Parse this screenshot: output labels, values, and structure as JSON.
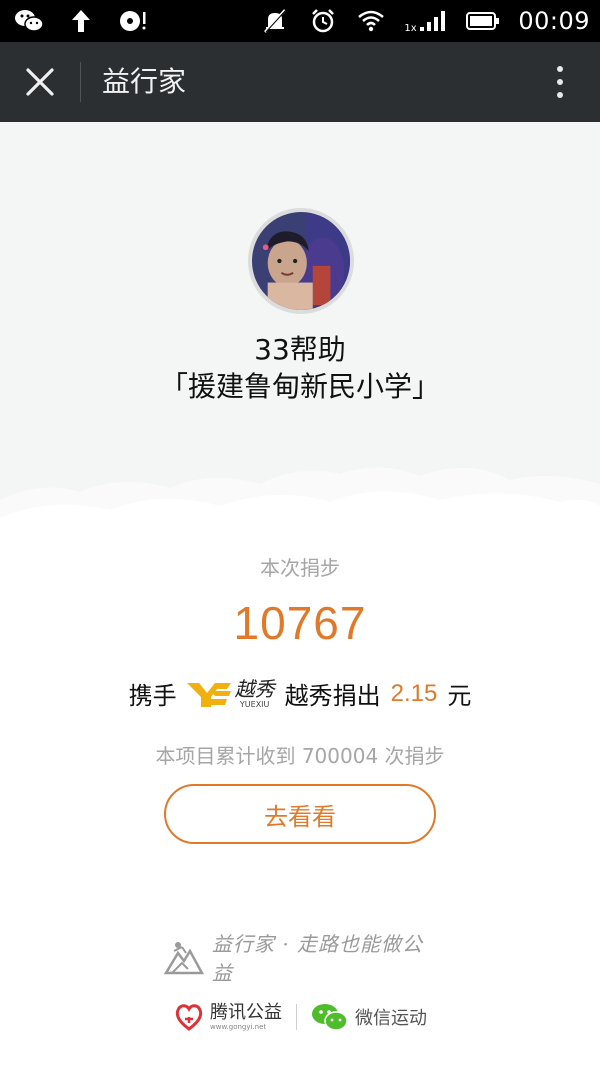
{
  "status_bar": {
    "time": "00:09",
    "network_label": "1x",
    "icons": [
      "wechat-icon",
      "upload-arrow-icon",
      "media-icon",
      "notification-muted-icon",
      "alarm-icon",
      "wifi-icon",
      "signal-icon",
      "battery-icon"
    ]
  },
  "titlebar": {
    "title": "益行家",
    "close_icon": "close-icon",
    "more_icon": "more-vertical-icon"
  },
  "hero": {
    "title": "33帮助",
    "subtitle": "「援建鲁甸新民小学」"
  },
  "donation": {
    "label": "本次捐步",
    "steps": "10767",
    "prefix": "携手",
    "sponsor_logo_text": "越秀",
    "sponsor_logo_sub": "YUEXIU",
    "middle": "越秀捐出",
    "amount": "2.15",
    "unit": "元",
    "accum_text": "本项目累计收到 700004 次捐步",
    "button_label": "去看看"
  },
  "footer": {
    "brand": "益行家 · 走路也能做公益",
    "tencent_label": "腾讯公益",
    "tencent_url": "www.gongyi.net",
    "wechat_label": "微信运动"
  },
  "colors": {
    "accent": "#e07a2a",
    "titlebar_bg": "#2b2f32",
    "statusbar_bg": "#000000",
    "hero_bg": "#f4f5f5",
    "muted_text": "#a6a6a6"
  }
}
